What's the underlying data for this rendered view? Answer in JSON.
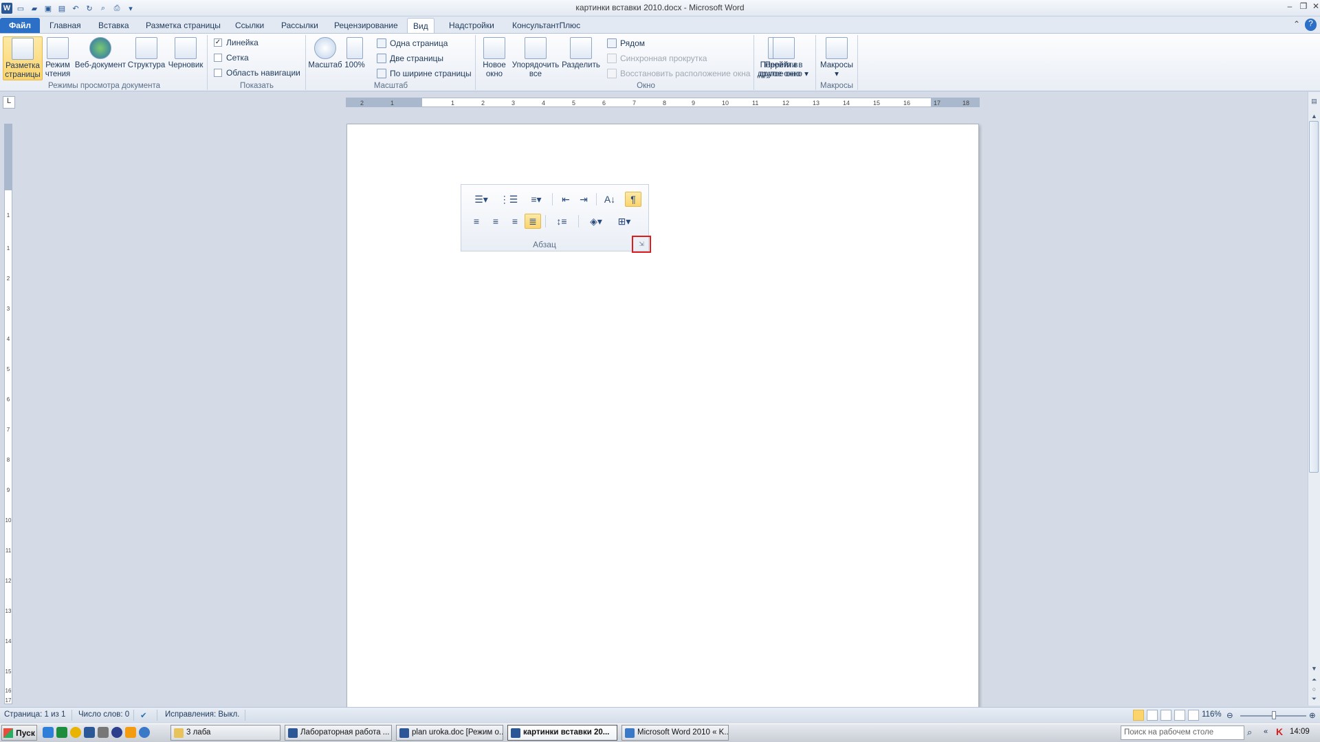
{
  "window": {
    "title": "картинки вставки 2010.docx - Microsoft Word"
  },
  "tabs": [
    "Файл",
    "Главная",
    "Вставка",
    "Разметка страницы",
    "Ссылки",
    "Рассылки",
    "Рецензирование",
    "Вид",
    "Надстройки",
    "КонсультантПлюс"
  ],
  "active_tab": "Вид",
  "ribbon": {
    "views": {
      "label": "Режимы просмотра документа",
      "buttons": [
        "Разметка страницы",
        "Режим чтения",
        "Веб-документ",
        "Структура",
        "Черновик"
      ]
    },
    "show": {
      "label": "Показать",
      "checks": [
        {
          "label": "Линейка",
          "checked": "✓"
        },
        {
          "label": "Сетка",
          "checked": ""
        },
        {
          "label": "Область навигации",
          "checked": ""
        }
      ]
    },
    "zoom": {
      "label": "Масштаб",
      "zoom_btn": "Масштаб",
      "hundred_btn": "100%",
      "options": [
        "Одна страница",
        "Две страницы",
        "По ширине страницы"
      ]
    },
    "window": {
      "label": "Окно",
      "new_window": "Новое окно",
      "arrange_all": "Упорядочить все",
      "split": "Разделить",
      "side_by_side": "Рядом",
      "sync_scroll": "Синхронная прокрутка",
      "reset_pos": "Восстановить расположение окна",
      "switch_window": "Перейти в другое окно"
    },
    "macros": {
      "label": "Макросы",
      "button": "Макросы"
    }
  },
  "ruler": {
    "h_ticks": [
      "2",
      "1",
      "1",
      "2",
      "3",
      "4",
      "5",
      "6",
      "7",
      "8",
      "9",
      "10",
      "11",
      "12",
      "13",
      "14",
      "15",
      "16",
      "17",
      "18"
    ],
    "v_ticks": [
      "1",
      "1",
      "2",
      "3",
      "4",
      "5",
      "6",
      "7",
      "8",
      "9",
      "10",
      "11",
      "12",
      "13",
      "14",
      "15",
      "16",
      "17"
    ]
  },
  "paragraph_image": {
    "label": "Абзац"
  },
  "status": {
    "page": "Страница: 1 из 1",
    "words": "Число слов: 0",
    "track": "Исправления: Выкл.",
    "zoom": "116%"
  },
  "taskbar": {
    "start": "Пуск",
    "items": [
      "3 лаба",
      "Лабораторная работа ...",
      "plan uroka.doc [Режим о...",
      "картинки вставки 20...",
      "Microsoft Word 2010 « K..."
    ],
    "search_placeholder": "Поиск на рабочем столе",
    "clock": "14:09"
  }
}
